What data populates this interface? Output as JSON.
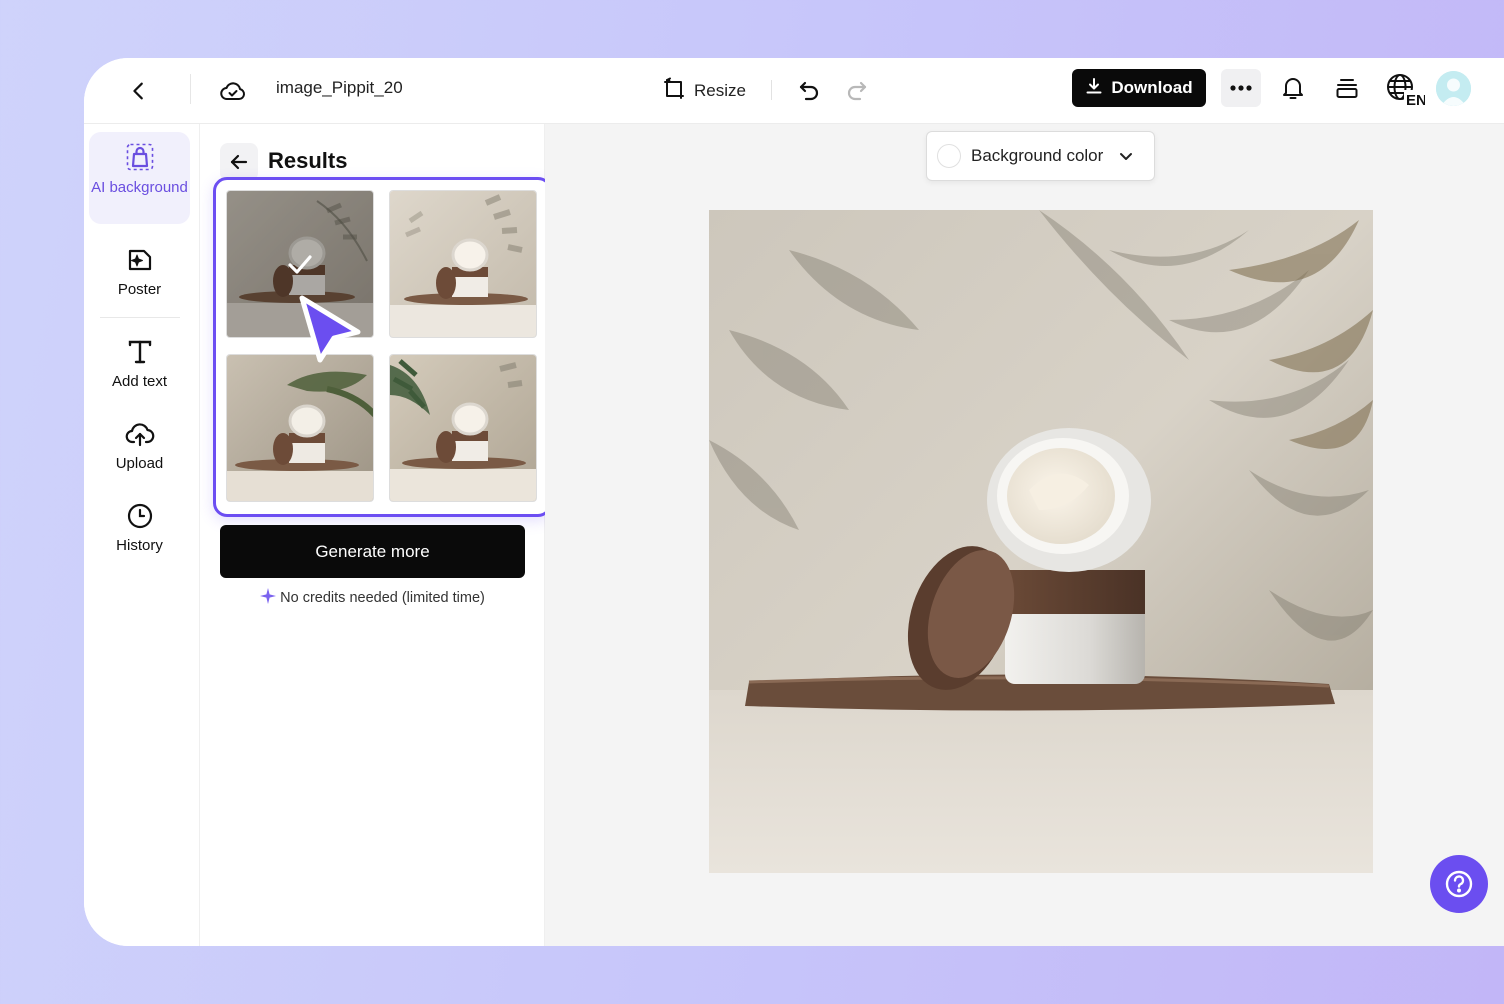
{
  "topbar": {
    "file_name": "image_Pippit_20",
    "resize_label": "Resize",
    "download_label": "Download",
    "lang_code": "EN"
  },
  "rail": {
    "items": [
      {
        "label": "AI background",
        "icon": "bag-sparkle-icon",
        "active": true
      },
      {
        "label": "Poster",
        "icon": "poster-icon",
        "active": false
      },
      {
        "label": "Add text",
        "icon": "text-icon",
        "active": false
      },
      {
        "label": "Upload",
        "icon": "cloud-upload-icon",
        "active": false
      },
      {
        "label": "History",
        "icon": "clock-icon",
        "active": false
      }
    ]
  },
  "panel": {
    "title": "Results",
    "generate_label": "Generate more",
    "credits_note": "No credits needed (limited time)",
    "selected_index": 0,
    "result_count": 4
  },
  "canvas": {
    "bg_color_label": "Background color"
  },
  "colors": {
    "accent": "#6c4ef2",
    "primary_button": "#0a0a0a",
    "help_button": "#6b4ef0",
    "active_rail_bg": "#f1f0fc"
  }
}
